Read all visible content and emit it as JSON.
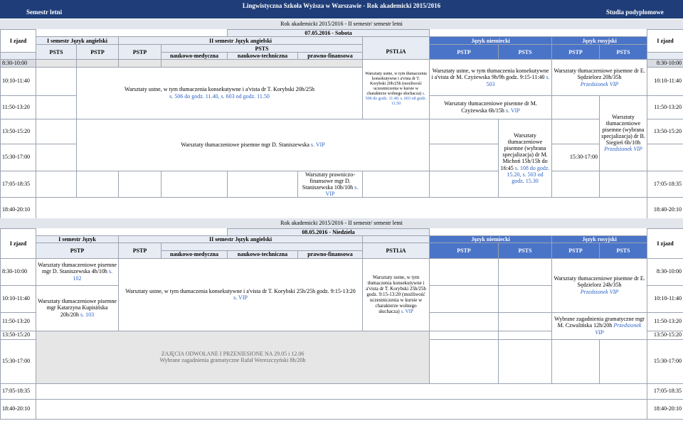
{
  "header": {
    "left": "Semestr letni",
    "title": "Lingwistyczna Szkoła Wyższa w Warszawie - Rok akademicki 2015/2016",
    "right": "Studia podyplomowe"
  },
  "block1": {
    "year_header": "Rok akademicki 2015/2016 - II semestr/ semestr letni",
    "date": "07.05.2016 - Sobota",
    "zjazd": "I zjazd",
    "groups": {
      "sem1": "I semestr Język angielski",
      "sem2": "II semestr Język angielski",
      "niem": "Język niemiecki",
      "ros": "Język rosyjski"
    },
    "sub": {
      "psts1": "PSTS",
      "pstp1": "PSTP",
      "pstp2": "PSTP",
      "psts2": "PSTS",
      "pstlia": "PSTLiA",
      "pstp3": "PSTP",
      "psts3": "PSTS",
      "pstp4": "PSTP",
      "psts4": "PSTS",
      "med": "naukowo-medyczna",
      "tech": "naukowo-techniczna",
      "praw": "prawno-finansowa"
    },
    "times": [
      "8:30-10:00",
      "10:10-11:40",
      "11:50-13:20",
      "13:50-15:20",
      "15:30-17:00",
      "17:05-18:35",
      "18:40-20:10"
    ],
    "cells": {
      "ustne_main": "Warsztaty ustne, w tym tłumaczenia konsekutywne i a'vista dr T. Korybski 20h/25h",
      "ustne_main_room": "s. 506 do godz. 11.40, s. 603 od godz. 11.50",
      "pisemne_main": "Warsztaty tłumaczeniowe pisemne mgr D. Staniszewska",
      "pisemne_main_room": "s. VIP",
      "prawnicze": "Warsztaty prawniczo-finansowe mgr D. Staniszewska 10h/10h",
      "prawnicze_room": "s. VIP",
      "pstlia_ustne": "Warsztaty ustne, w tym tłumaczenia konsekutywne i a'vista dr T. Korybski 20h/25h (możliwość uczestniczenia w kursie w charakterze wolnego słuchacza)",
      "pstlia_ustne_room": "s. 506 do godz. 11.40, s. 603 od godz. 11.50",
      "niem_ustne": "Warsztaty ustne, w tym tłumaczenia konsekutywne i a'vista dr M. Czyżewska 9h/9h godz. 9:15-11:40",
      "niem_ustne_room": "s. 503",
      "niem_pisemne": "Warsztaty tłumaczeniowe pisemne dr M. Czyżewska 6h/15h",
      "niem_pisemne_room": "s. VIP",
      "niem_spec": "Warsztaty tłumaczeniowe pisemne (wybrana specjalizacja) dr M. Michoń 15h/15h do 16:45",
      "niem_spec_room": "s. 108 do godz. 15.20, s. 503 od godz. 15.30",
      "ros_pisemne": "Warsztaty tłumaczeniowe pisemne dr E. Sędzielorz 20h/35h",
      "ros_pisemne_room": "Przedsionek VIP",
      "ros_spec": "Warsztaty tłumaczeniowe pisemne (wybrana specjalizacja) dr B. Siegień 6h/10h",
      "ros_spec_room": "Przedsionek VIP"
    }
  },
  "block2": {
    "year_header": "Rok akademicki 2015/2016 - II semestr/ semestr letni",
    "date": "08.05.2016 - Niedziela",
    "zjazd": "I zjazd",
    "groups": {
      "sem1": "I semestr Język",
      "sem2": "II semestr Język angielski",
      "niem": "Język niemiecki",
      "ros": "Język rosyjski"
    },
    "sub": {
      "pstp1": "PSTP",
      "pstp2": "PSTP",
      "pstlia": "PSTLiA",
      "pstp3": "PSTP",
      "psts3": "PSTS",
      "pstp4": "PSTP",
      "psts4": "PSTS",
      "med": "naukowo-medyczna",
      "tech": "naukowo-techniczna",
      "praw": "prawno-finansowa"
    },
    "times": [
      "8:30-10:00",
      "10:10-11:40",
      "11:50-13:20",
      "13:50-15:20",
      "15:30-17:00",
      "17:05-18:35",
      "18:40-20:10"
    ],
    "cells": {
      "sem1_pis1": "Warsztaty tłumaczeniowe pisemne mgr D. Staniszewska 4h/10h",
      "sem1_pis1_room": "s. 102",
      "sem1_pis2": "Warsztaty tłumaczeniowe pisemne mgr Katarzyna Kupisińska 20h/20h",
      "sem1_pis2_room": "s. 103",
      "ustne_main": "Warsztaty ustne, w tym tłumaczenia konsekutywne i a'vista dr T. Korybski 25h/25h godz. 9:15-13:20",
      "ustne_main_room": "s. VIP",
      "cancel1": "ZAJĘCIA ODWOŁANE I PRZENIESIONE NA 29.05 i 12.06",
      "cancel2": "Wybrane zagadnienia gramatyczne Rafał Wereszczyński 8h/20h",
      "pstlia_ustne": "Warsztaty ustne, w tym tłumaczenia konsekutywne i a'vista dr T. Korybski 25h/25h godz. 9:15-13:20 (możliwość uczestniczenia w kursie w charakterze wolnego słuchacza)",
      "pstlia_ustne_room": "s. VIP",
      "ros_pisemne": "Warsztaty tłumaczeniowe pisemne dr E. Sędzielorz 24h/35h",
      "ros_pisemne_room": "Przedsionek VIP",
      "ros_gram": "Wybrane zagadnienia gramatyczne mgr M. Czwalińska 12h/20h",
      "ros_gram_room": "Przedsionek VIP"
    }
  }
}
